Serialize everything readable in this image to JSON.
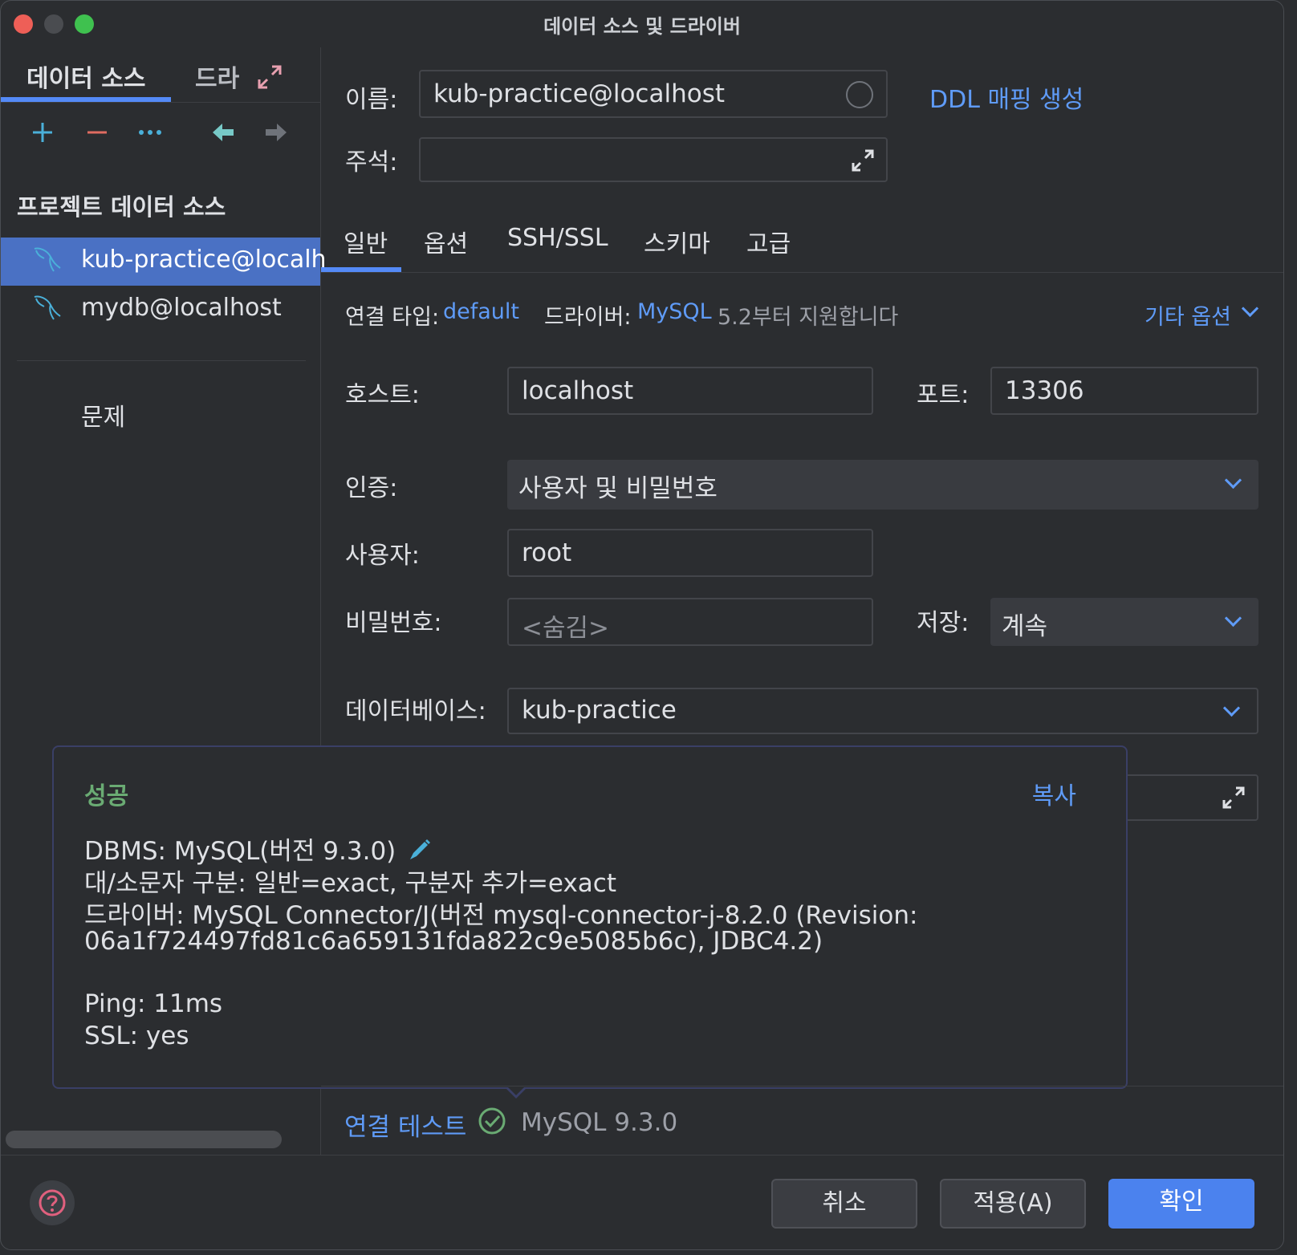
{
  "window": {
    "title": "데이터 소스 및 드라이버"
  },
  "left": {
    "tabs": [
      "데이터 소스",
      "드라"
    ],
    "section_title": "프로젝트 데이터 소스",
    "items": [
      "kub-practice@localh",
      "mydb@localhost"
    ],
    "problems": "문제"
  },
  "form": {
    "name_label": "이름:",
    "name_value": "kub-practice@localhost",
    "ddl_link": "DDL 매핑 생성",
    "comment_label": "주석:",
    "tabs": [
      "일반",
      "옵션",
      "SSH/SSL",
      "스키마",
      "고급"
    ],
    "connection_type_label": "연결 타입:",
    "connection_type_value": "default",
    "driver_label": "드라이버:",
    "driver_value": "MySQL",
    "driver_note": "5.2부터 지원합니다",
    "more_options": "기타 옵션",
    "host_label": "호스트:",
    "host_value": "localhost",
    "port_label": "포트:",
    "port_value": "13306",
    "auth_label": "인증:",
    "auth_value": "사용자 및 비밀번호",
    "user_label": "사용자:",
    "user_value": "root",
    "password_label": "비밀번호:",
    "password_placeholder": "<숨김>",
    "save_label": "저장:",
    "save_value": "계속",
    "database_label": "데이터베이스:",
    "database_value": "kub-practice"
  },
  "popup": {
    "status": "성공",
    "copy": "복사",
    "lines": [
      "DBMS: MySQL(버전 9.3.0)",
      "대/소문자 구분: 일반=exact, 구분자 추가=exact",
      "드라이버: MySQL Connector/J(버전 mysql-connector-j-8.2.0 (Revision:",
      "06a1f724497fd81c6a659131fda822c9e5085b6c), JDBC4.2)",
      "Ping: 11ms",
      "SSL: yes"
    ]
  },
  "test": {
    "link": "연결 테스트",
    "result": "MySQL 9.3.0"
  },
  "buttons": {
    "cancel": "취소",
    "apply": "적용(A)",
    "ok": "확인"
  },
  "colors": {
    "accent": "#5f9bf7",
    "success": "#6aab73",
    "primary_button": "#4b82ee"
  },
  "icons": [
    "add-icon",
    "remove-icon",
    "more-icon",
    "back-icon",
    "forward-icon",
    "expand-icon",
    "mysql-dolphin-icon",
    "pencil-icon",
    "check-circle-icon",
    "help-icon",
    "chevron-down-icon"
  ]
}
